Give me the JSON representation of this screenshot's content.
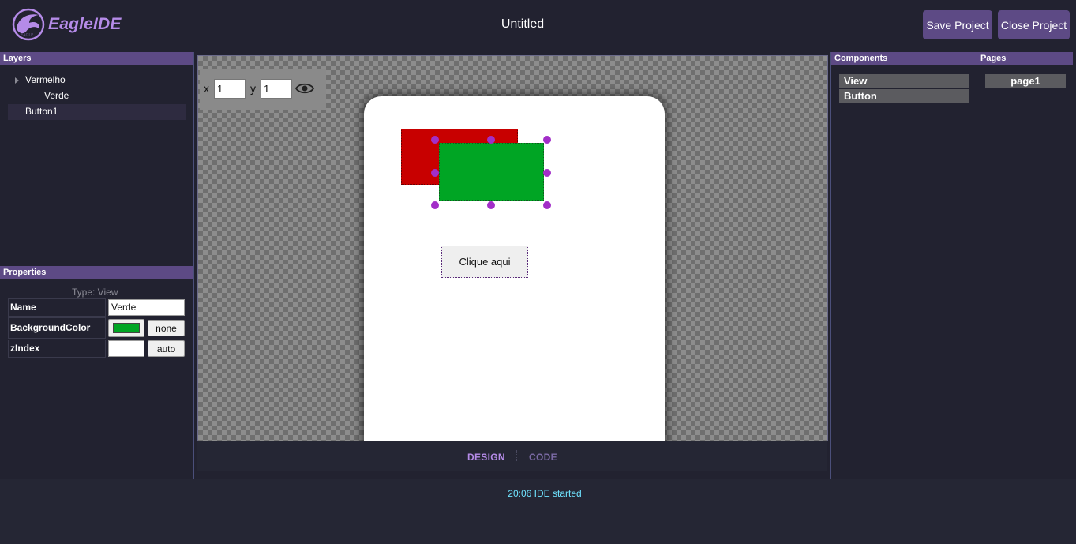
{
  "header": {
    "logo_text": "EagleIDE",
    "title": "Untitled",
    "save_label": "Save Project",
    "close_label": "Close Project"
  },
  "layers": {
    "title": "Layers",
    "items": [
      {
        "label": "Vermelho",
        "expanded": false,
        "has_children": true
      },
      {
        "label": "Verde"
      },
      {
        "label": "Button1",
        "selected": true
      }
    ]
  },
  "properties": {
    "title": "Properties",
    "type_label": "Type: View",
    "rows": [
      {
        "label": "Name",
        "value": "Verde"
      },
      {
        "label": "BackgroundColor",
        "color": "#00a524",
        "button": "none"
      },
      {
        "label": "zIndex",
        "value": "",
        "button": "auto"
      }
    ]
  },
  "canvas": {
    "x_label": "x",
    "x_value": "1",
    "y_label": "y",
    "y_value": "1",
    "eye_icon": "eye-icon",
    "views": [
      {
        "name": "Vermelho",
        "color": "#c80000"
      },
      {
        "name": "Verde",
        "color": "#00a524"
      }
    ],
    "button_text": "Clique aqui",
    "handle_color": "#a22ec8"
  },
  "tabs": [
    {
      "label": "DESIGN",
      "active": true
    },
    {
      "label": "CODE",
      "active": false
    }
  ],
  "components": {
    "title": "Components",
    "items": [
      "View",
      "Button"
    ]
  },
  "pages": {
    "title": "Pages",
    "items": [
      "page1"
    ]
  },
  "console": {
    "lines": [
      "20:06 IDE started"
    ]
  },
  "colors": {
    "accent": "#5d4a85",
    "logo": "#b58be8",
    "background": "#222230",
    "console_text": "#6fe3ff"
  }
}
